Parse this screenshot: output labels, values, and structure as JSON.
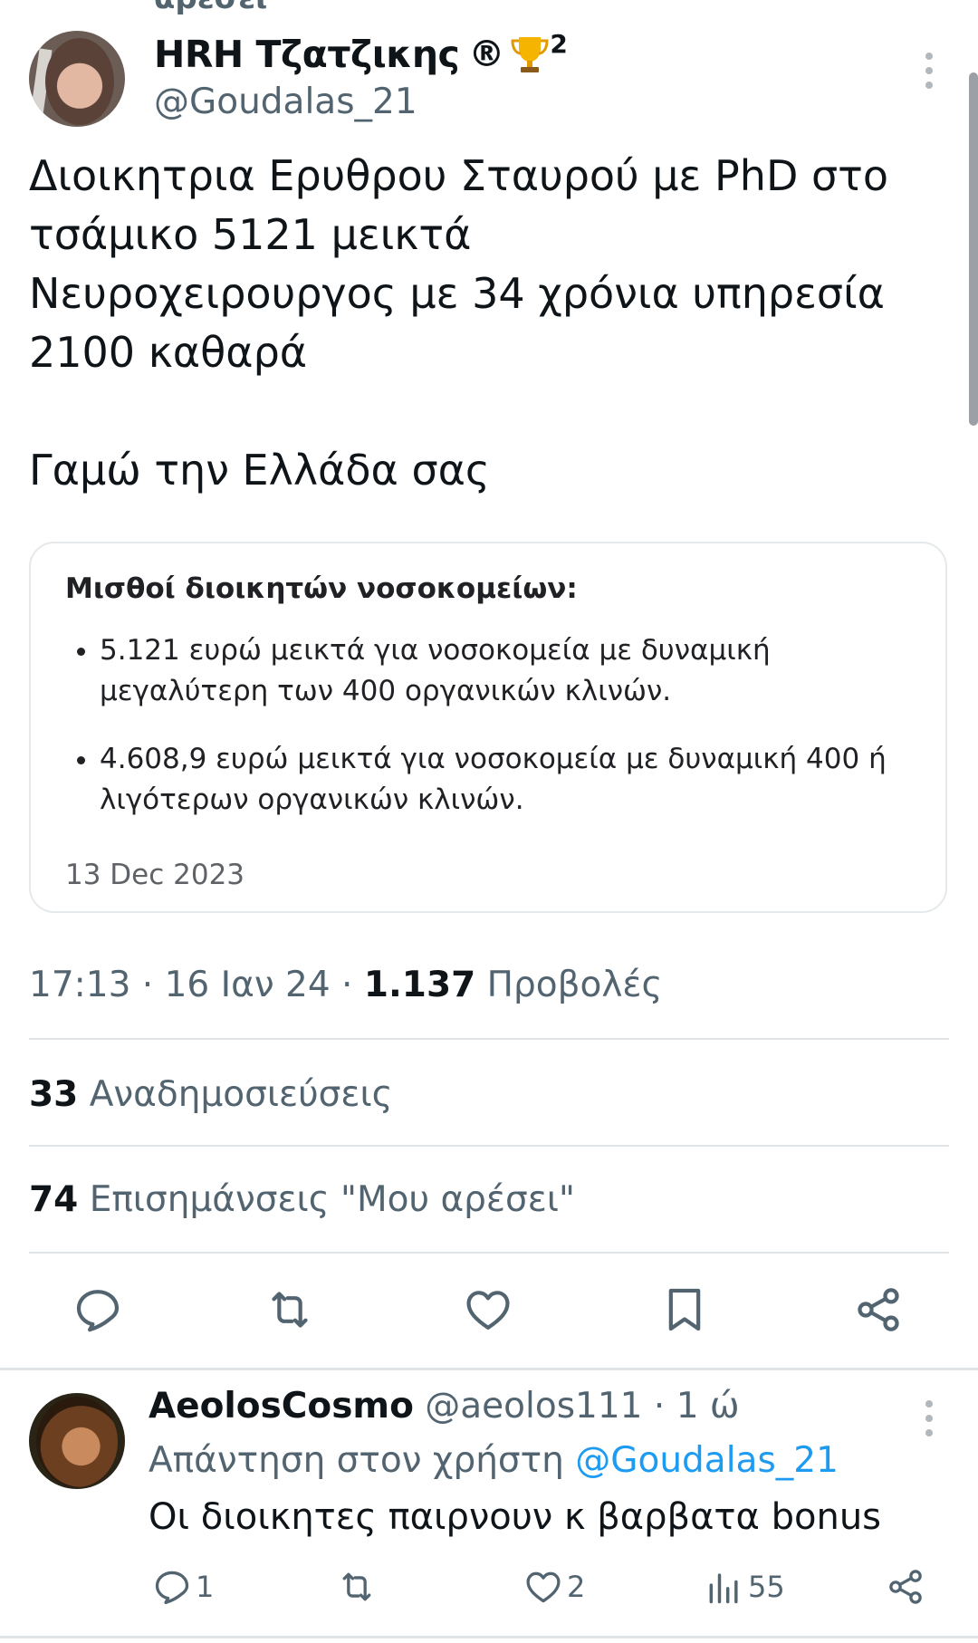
{
  "top_cut_text": "αρέσει",
  "tweet": {
    "display_name": "HRH Τζατζικης",
    "reg_mark": "®",
    "sup": "2",
    "handle": "@Goudalas_21",
    "text": "Διοικητρια Ερυθρου Σταυρού με PhD στο\nτσάμικο 5121 μεικτά\nΝευροχειρουργος με 34 χρόνια υπηρεσία\n2100 καθαρά\n\nΓαμώ την Ελλάδα σας",
    "card": {
      "title": "Μισθοί διοικητών νοσοκομείων:",
      "items": [
        "5.121 ευρώ μεικτά για νοσοκομεία με δυναμική μεγαλύτερη των 400 οργανικών κλινών.",
        "4.608,9 ευρώ μεικτά για νοσοκομεία με δυναμική 400 ή λιγότερων οργανικών κλινών."
      ],
      "date": "13 Dec 2023"
    },
    "time": "17:13",
    "date": "16 Ιαν 24",
    "views_count": "1.137",
    "views_label": "Προβολές",
    "reposts_count": "33",
    "reposts_label": "Αναδημοσιεύσεις",
    "likes_count": "74",
    "likes_label": "Επισημάνσεις \"Μου αρέσει\""
  },
  "reply": {
    "display_name": "AeolosCosmo",
    "handle": "@aeolos111",
    "time": "1 ώ",
    "reply_to_label": "Απάντηση στον χρήστη",
    "reply_to_handle": "@Goudalas_21",
    "text": "Οι διοικητες παιρνουν κ βαρβατα bonus",
    "replies": "1",
    "likes": "2",
    "views": "55"
  },
  "icons": {
    "reply": "reply-icon",
    "repost": "repost-icon",
    "like": "heart-icon",
    "bookmark": "bookmark-icon",
    "share": "share-icon",
    "views": "views-icon",
    "trophy": "trophy-icon"
  },
  "colors": {
    "text": "#0f1419",
    "secondary": "#536471",
    "link": "#1d9bf0",
    "divider": "#e1e4e6"
  }
}
